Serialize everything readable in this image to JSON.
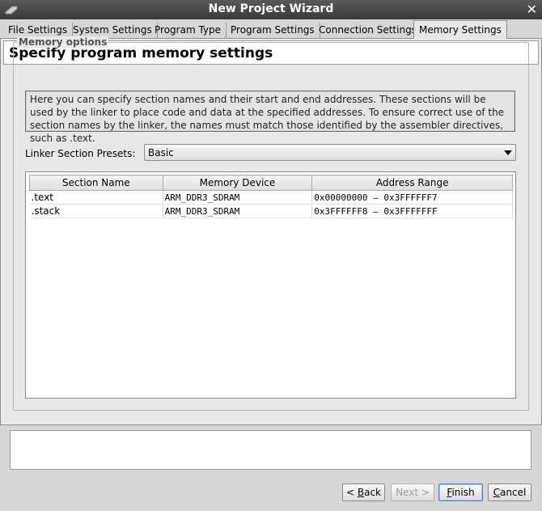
{
  "window": {
    "title": "New Project Wizard"
  },
  "tabs": [
    {
      "label": "File Settings"
    },
    {
      "label": "System Settings"
    },
    {
      "label": "Program Type"
    },
    {
      "label": "Program Settings"
    },
    {
      "label": "Connection Settings"
    },
    {
      "label": "Memory Settings"
    }
  ],
  "active_tab": "Memory Settings",
  "header": {
    "title": "Specify program memory settings"
  },
  "memory_options": {
    "legend": "Memory options",
    "info_text": "Here you can specify section names and their start and end addresses. These sections will be used by the linker to place code and data at the specified addresses. To ensure correct use of the section names by the linker, the names must match those identified by the assembler directives, such as .text.",
    "presets_label": "Linker Section Presets:",
    "presets_value": "Basic"
  },
  "table": {
    "columns": [
      "Section Name",
      "Memory Device",
      "Address Range"
    ],
    "rows": [
      {
        "name": ".text",
        "device": "ARM_DDR3_SDRAM",
        "range": "0x00000000  –  0x3FFFFFF7"
      },
      {
        "name": ".stack",
        "device": "ARM_DDR3_SDRAM",
        "range": "0x3FFFFFF8  –  0x3FFFFFFF"
      }
    ]
  },
  "buttons": {
    "back_prefix": "< ",
    "back_mnemonic": "B",
    "back_rest": "ack",
    "next_label": "Next >",
    "finish_mnemonic": "F",
    "finish_rest": "inish",
    "cancel_mnemonic": "C",
    "cancel_rest": "ancel"
  }
}
